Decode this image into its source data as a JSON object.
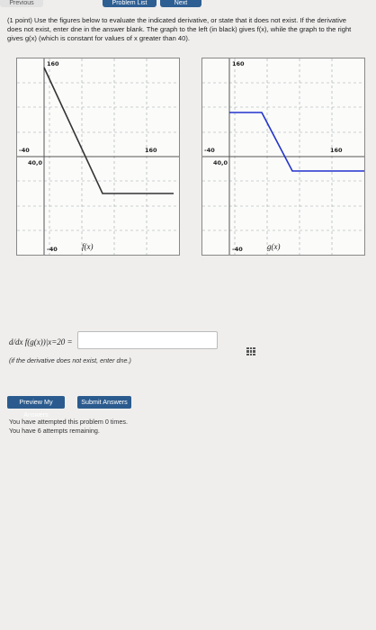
{
  "nav": {
    "previous": "Previous",
    "list": "Problem List",
    "next": "Next"
  },
  "problem": {
    "points": "(1 point)",
    "text": "Use the figures below to evaluate the indicated derivative, or state that it does not exist. If the derivative does not exist, enter dne in the answer blank. The graph to the left (in black) gives f(x), while the graph to the right gives g(x) (which is constant for values of x greater than 40)."
  },
  "graph_f": {
    "label": "f(x)",
    "tick_top": "160",
    "tick_left": "-40",
    "tick_right": "160",
    "tick_origin_bottom": "-40",
    "tick_x": "40,0",
    "tick_y": "40,0"
  },
  "graph_g": {
    "label": "g(x)",
    "tick_top": "160",
    "tick_left": "-40",
    "tick_right": "160",
    "tick_origin_bottom": "-40",
    "tick_x": "40,0",
    "tick_y": "40,0"
  },
  "question": {
    "expression": "d/dx f(g(x))|x=20 =",
    "hint": "(if the derivative does not exist, enter dne.)",
    "answer_value": ""
  },
  "buttons": {
    "preview": "Preview My Answers",
    "submit": "Submit Answers"
  },
  "status": {
    "attempts": "You have attempted this problem 0 times.",
    "remaining": "You have 6 attempts remaining."
  },
  "colors": {
    "f_curve": "#333333",
    "g_curve": "#2233cc",
    "button": "#2b5b8e"
  }
}
